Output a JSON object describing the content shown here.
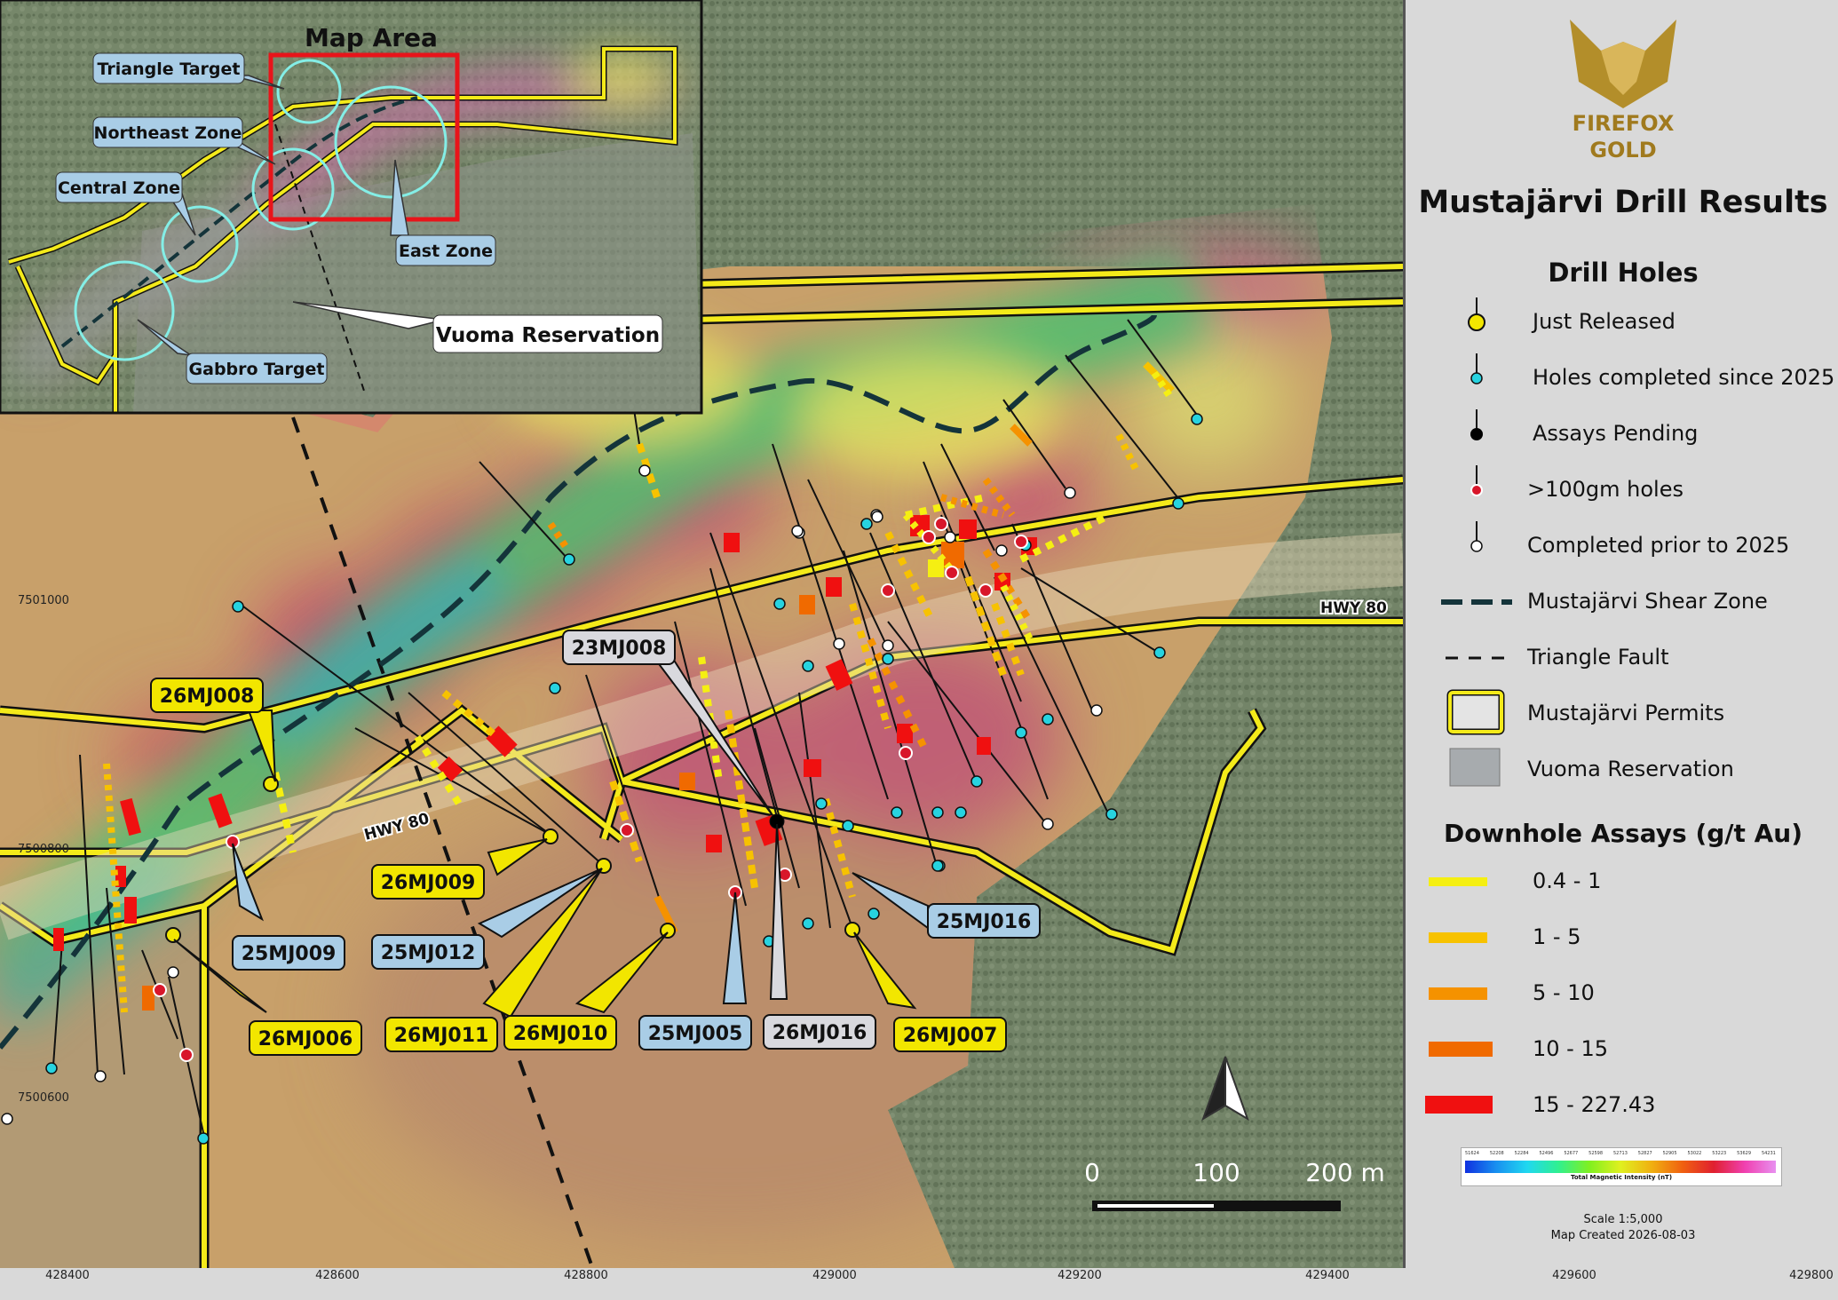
{
  "map": {
    "inset_title": "Map Area",
    "inset_labels": {
      "triangle_target": "Triangle Target",
      "northeast_zone": "Northeast Zone",
      "central_zone": "Central Zone",
      "east_zone": "East Zone",
      "gabbro_target": "Gabbro Target",
      "vuoma_reservation": "Vuoma Reservation"
    },
    "road_label": "HWY 80",
    "hole_labels": {
      "h26MJ008": "26MJ008",
      "h26MJ009": "26MJ009",
      "h25MJ009": "25MJ009",
      "h25MJ012": "25MJ012",
      "h26MJ006": "26MJ006",
      "h26MJ011": "26MJ011",
      "h26MJ010": "26MJ010",
      "h25MJ005": "25MJ005",
      "h26MJ016": "26MJ016",
      "h26MJ007": "26MJ007",
      "h25MJ016": "25MJ016",
      "h23MJ008": "23MJ008"
    },
    "scale_bar": {
      "t0": "0",
      "t100": "100",
      "t200": "200 m"
    },
    "easting_ticks": [
      "428400",
      "428600",
      "428800",
      "429000",
      "429200",
      "429400",
      "429600",
      "429800"
    ],
    "northing_ticks": [
      "7501000",
      "7500800",
      "7500600"
    ],
    "colors": {
      "just_released": "#f2e600",
      "since_2025": "#27d3e0",
      "pending": "#000000",
      "over100": "#d8162a",
      "prior": "#ffffff",
      "permit": "#f4ea1a"
    }
  },
  "legend": {
    "logo_line1": "FIREFOX",
    "logo_line2": "GOLD",
    "title": "Mustajärvi Drill Results",
    "drill_holes_heading": "Drill Holes",
    "items": {
      "just_released": "Just Released",
      "since_2025": "Holes completed since 2025",
      "pending": "Assays Pending",
      "over100": ">100gm holes",
      "prior": "Completed prior to 2025",
      "shear": "Mustajärvi Shear Zone",
      "fault": "Triangle Fault",
      "permits": "Mustajärvi Permits",
      "reservation": "Vuoma Reservation"
    },
    "assays_heading": "Downhole Assays (g/t Au)",
    "assay_classes": [
      {
        "label": "0.4 - 1",
        "color": "#f5ef12"
      },
      {
        "label": "1 - 5",
        "color": "#f7c200"
      },
      {
        "label": "5 - 10",
        "color": "#f59200"
      },
      {
        "label": "10 - 15",
        "color": "#f06a00"
      },
      {
        "label": "15 - 227.43",
        "color": "#f01010"
      }
    ],
    "colorbar_caption": "Total Magnetic Intensity (nT)",
    "colorbar_ticks": [
      "51624",
      "52208",
      "52284",
      "52496",
      "52677",
      "52598",
      "52713",
      "52827",
      "52905",
      "53022",
      "53223",
      "53629",
      "54231"
    ],
    "scale_text": "Scale 1:5,000",
    "created_text": "Map Created 2026-08-03"
  }
}
